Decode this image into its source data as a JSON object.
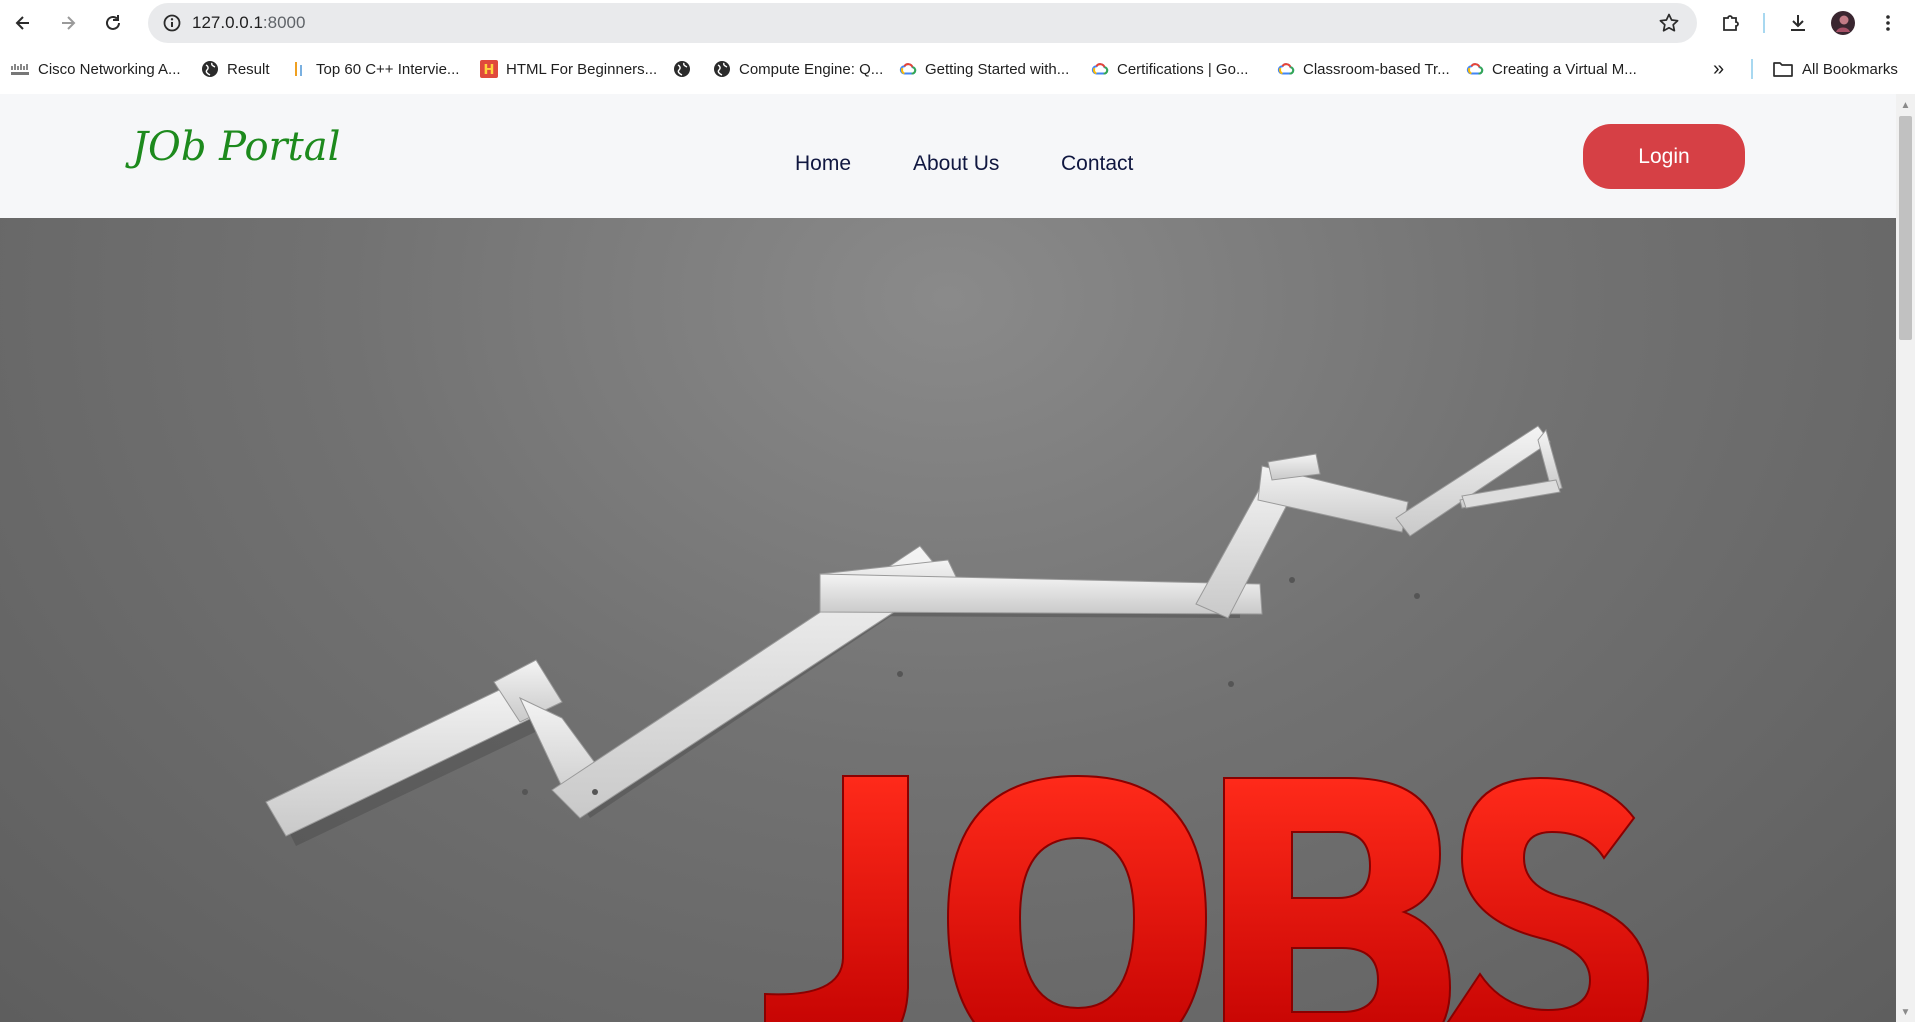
{
  "browser": {
    "url_host": "127.0.0.1",
    "url_port": ":8000",
    "icons": {
      "back": "arrow-left-icon",
      "forward": "arrow-right-icon",
      "reload": "reload-icon",
      "site_info": "site-info-icon",
      "bookmark_star": "star-icon",
      "extensions": "puzzle-icon",
      "downloads": "download-icon",
      "menu": "kebab-menu-icon"
    }
  },
  "bookmarks": {
    "items": [
      {
        "label": "Cisco Networking A..."
      },
      {
        "label": "Result"
      },
      {
        "label": "Top 60 C++ Intervie..."
      },
      {
        "label": "HTML For Beginners..."
      },
      {
        "label": ""
      },
      {
        "label": "Compute Engine: Q..."
      },
      {
        "label": "Getting Started with..."
      },
      {
        "label": "Certifications  |  Go..."
      },
      {
        "label": "Classroom-based Tr..."
      },
      {
        "label": "Creating a Virtual M..."
      }
    ],
    "overflow": "»",
    "all_bookmarks": "All Bookmarks"
  },
  "page": {
    "brand": "JOb Portal",
    "nav": {
      "home": "Home",
      "about": "About Us",
      "contact": "Contact"
    },
    "login_label": "Login",
    "hero_text": "JOBS",
    "colors": {
      "brand": "#1d8a1d",
      "nav_text": "#101740",
      "login_bg": "#d64045",
      "hero_letters": "#e10f0f"
    }
  }
}
